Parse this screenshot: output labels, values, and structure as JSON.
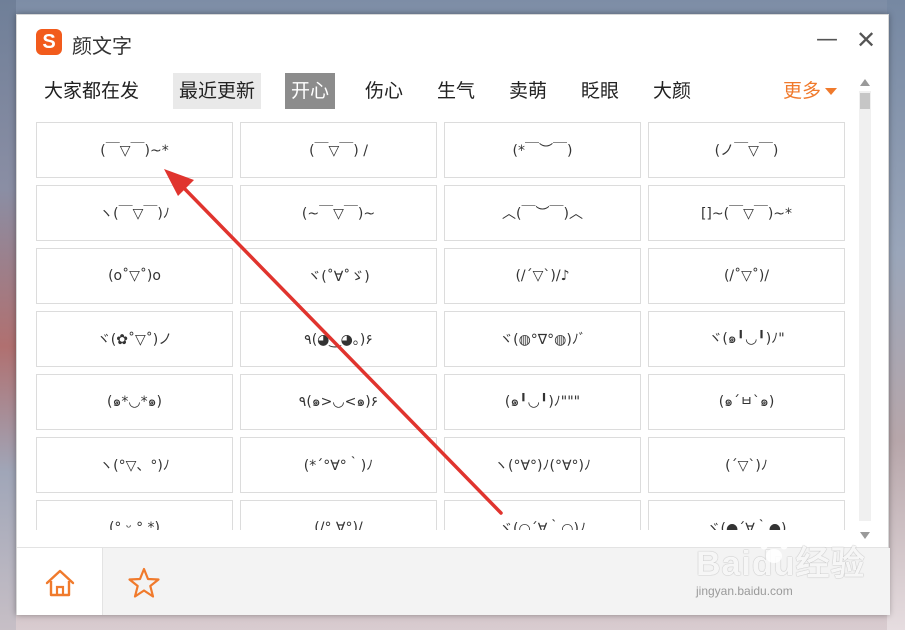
{
  "window": {
    "title": "颜文字",
    "logo_letter": "S",
    "minimize_glyph": "—",
    "close_glyph": "✕"
  },
  "tabs": [
    {
      "label": "大家都在发",
      "state": "normal"
    },
    {
      "label": "最近更新",
      "state": "hover"
    },
    {
      "label": "开心",
      "state": "active"
    },
    {
      "label": "伤心",
      "state": "normal"
    },
    {
      "label": "生气",
      "state": "normal"
    },
    {
      "label": "卖萌",
      "state": "normal"
    },
    {
      "label": "眨眼",
      "state": "normal"
    },
    {
      "label": "大颜",
      "state": "normal"
    }
  ],
  "more_label": "更多",
  "emoticons": [
    "(￣▽￣)~*",
    "(￣▽￣) /",
    "(*￣︶￣)",
    "(ノ￣▽￣)",
    "ヽ(￣▽￣)ﾉ",
    "(~￣▽￣)~",
    "︿(￣︶￣)︿",
    "[]~(￣▽￣)~*",
    "(o˚▽˚)o",
    "ヾ(˚∀˚ゞ)",
    "(/´▽`)/♪",
    "(/˚▽˚)/",
    "ヾ(✿˚▽˚)ノ",
    "٩(◕‿◕｡)۶",
    "ヾ(◍°∇°◍)ﾉﾞ",
    "ヾ(๑╹◡╹)ﾉ\"",
    "(๑*◡*๑)",
    "٩(๑>◡<๑)۶",
    "(๑╹◡╹)ﾉ\"\"\"",
    "(๑´ㅂ`๑)",
    "ヽ(°▽、°)ﾉ",
    "(*´°∀°｀)ﾉ",
    "ヽ(°∀°)ﾉ(°∀°)ﾉ",
    "(´▽`)ﾉ",
    "(° ᵕ ° *)",
    "(/° ∀°)/",
    "ヾ(○´∀｀○)ﾉ",
    "ヾ(●´∀｀●)"
  ],
  "bottom": {
    "home_icon": "home-icon",
    "star_icon": "star-icon"
  },
  "watermark": {
    "main": "Baidu经验",
    "sub": "jingyan.baidu.com"
  },
  "colors": {
    "accent": "#f07a2c",
    "logo": "#f25b1c",
    "active_tab": "#8c8c8c",
    "arrow": "#e0342e"
  }
}
